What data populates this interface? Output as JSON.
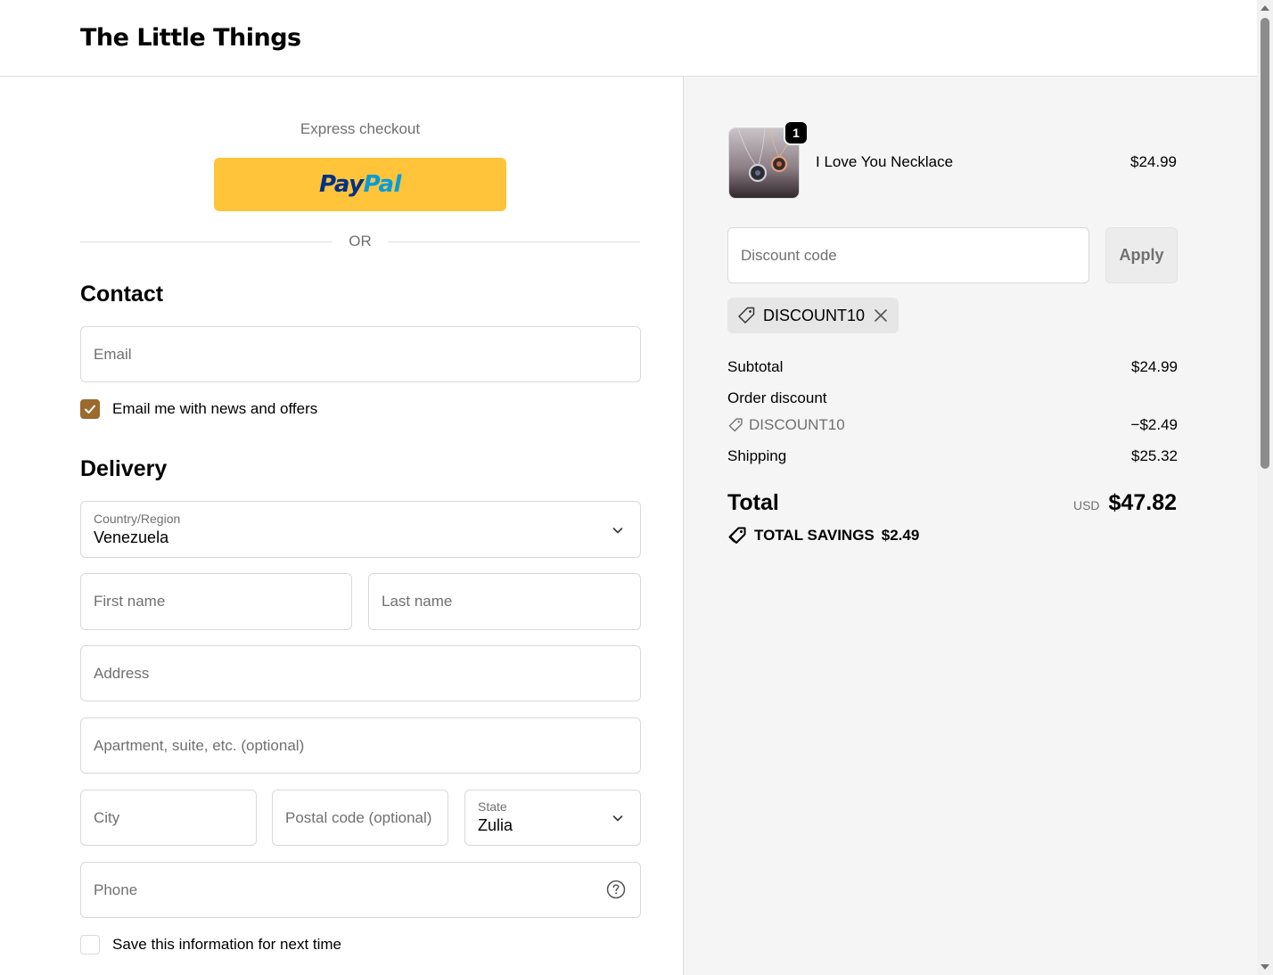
{
  "header": {
    "brand": "The Little Things"
  },
  "express": {
    "label": "Express checkout",
    "paypal_pay": "Pay",
    "paypal_pal": "Pal",
    "or": "OR"
  },
  "contact": {
    "title": "Contact",
    "email_placeholder": "Email",
    "news_label": "Email me with news and offers",
    "news_checked": true
  },
  "delivery": {
    "title": "Delivery",
    "country_label": "Country/Region",
    "country_value": "Venezuela",
    "first_name_placeholder": "First name",
    "last_name_placeholder": "Last name",
    "address_placeholder": "Address",
    "apartment_placeholder": "Apartment, suite, etc. (optional)",
    "city_placeholder": "City",
    "postal_placeholder": "Postal code (optional)",
    "state_label": "State",
    "state_value": "Zulia",
    "phone_placeholder": "Phone",
    "save_label": "Save this information for next time",
    "save_checked": false
  },
  "summary": {
    "product": {
      "name": "I Love You Necklace",
      "price": "$24.99",
      "quantity": "1"
    },
    "discount_placeholder": "Discount code",
    "apply_label": "Apply",
    "applied_code": "DISCOUNT10",
    "subtotal_label": "Subtotal",
    "subtotal_value": "$24.99",
    "order_discount_label": "Order discount",
    "order_discount_code": "DISCOUNT10",
    "order_discount_value": "−$2.49",
    "shipping_label": "Shipping",
    "shipping_value": "$25.32",
    "total_label": "Total",
    "total_currency": "USD",
    "total_value": "$47.82",
    "savings_label": "TOTAL SAVINGS",
    "savings_value": "$2.49"
  },
  "colors": {
    "accent": "#9b6a2e",
    "paypal_yellow": "#ffc439",
    "summary_bg": "#f5f5f5"
  }
}
